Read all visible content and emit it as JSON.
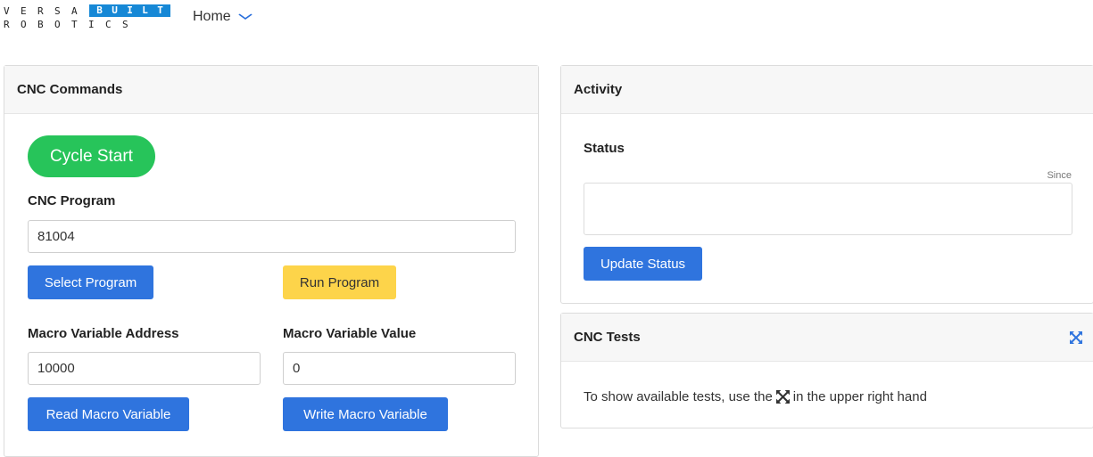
{
  "logo": {
    "row1_plain": [
      "V",
      "E",
      "R",
      "S",
      "A"
    ],
    "row1_highlight": [
      "B",
      "U",
      "I",
      "L",
      "T"
    ],
    "row2": [
      "R",
      "O",
      "B",
      "O",
      "T",
      "I",
      "C",
      "S"
    ],
    "accent_color": "#1688d6"
  },
  "nav": {
    "home_label": "Home",
    "chevron_icon": "chevron-down-icon"
  },
  "cnc_commands": {
    "title": "CNC Commands",
    "cycle_start_label": "Cycle Start",
    "program_label": "CNC Program",
    "program_value": "81004",
    "select_program_label": "Select Program",
    "run_program_label": "Run Program",
    "macro_address_label": "Macro Variable Address",
    "macro_address_value": "10000",
    "macro_value_label": "Macro Variable Value",
    "macro_value_value": "0",
    "read_macro_label": "Read Macro Variable",
    "write_macro_label": "Write Macro Variable"
  },
  "activity": {
    "title": "Activity",
    "status_label": "Status",
    "since_label": "Since",
    "update_status_label": "Update Status"
  },
  "cnc_tests": {
    "title": "CNC Tests",
    "hint_before": "To show available tests, use the",
    "hint_after": "in the upper right hand",
    "icon": "expand-icon"
  },
  "colors": {
    "primary": "#2f74de",
    "success": "#27c45a",
    "warning": "#fdd44a"
  }
}
